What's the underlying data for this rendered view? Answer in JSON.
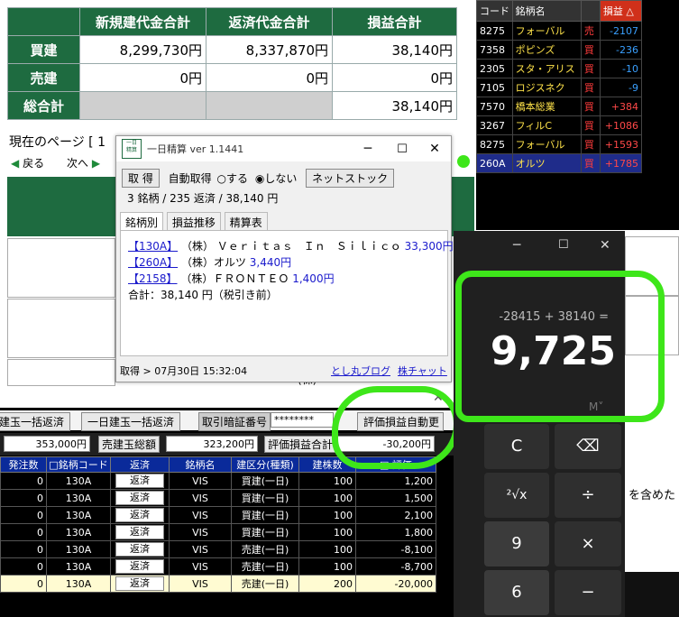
{
  "summary": {
    "headers": [
      "新規建代金合計",
      "返済代金合計",
      "損益合計"
    ],
    "rows": [
      {
        "label": "買建",
        "values": [
          "8,299,730円",
          "8,337,870円",
          "38,140円"
        ]
      },
      {
        "label": "売建",
        "values": [
          "0円",
          "0円",
          "0円"
        ]
      },
      {
        "label": "総合計",
        "values": [
          "",
          "",
          "38,140円"
        ]
      }
    ]
  },
  "page_nav": {
    "current_page_label": "現在のページ [ 1",
    "back_label": "戻る",
    "next_label": "次へ",
    "back_arrow": "◀",
    "next_arrow": "▶"
  },
  "stock_list": {
    "headers": [
      "コード",
      "銘柄名",
      "",
      "損益 △"
    ],
    "rows": [
      {
        "code": "8275",
        "name": "フォーバル",
        "side": "売",
        "pnl": "-2107",
        "sign": "neg"
      },
      {
        "code": "7358",
        "name": "ポピンズ",
        "side": "買",
        "pnl": "-236",
        "sign": "neg"
      },
      {
        "code": "2305",
        "name": "スタ・アリス",
        "side": "買",
        "pnl": "-10",
        "sign": "neg"
      },
      {
        "code": "7105",
        "name": "ロジスネク",
        "side": "買",
        "pnl": "-9",
        "sign": "neg"
      },
      {
        "code": "7570",
        "name": "橋本総業",
        "side": "買",
        "pnl": "+384",
        "sign": "pos"
      },
      {
        "code": "3267",
        "name": "フィルC",
        "side": "買",
        "pnl": "+1086",
        "sign": "pos"
      },
      {
        "code": "8275",
        "name": "フォーバル",
        "side": "買",
        "pnl": "+1593",
        "sign": "pos"
      },
      {
        "code": "260A",
        "name": "オルツ",
        "side": "買",
        "pnl": "+1785",
        "sign": "pos"
      }
    ]
  },
  "ichinichi": {
    "title": "一日精算 ver 1.1441",
    "icon_text": "一日\n精算",
    "get_button": "取 得",
    "auto_get_label": "自動取得",
    "radio_on": "する",
    "radio_off": "しない",
    "netstock_button": "ネットストック",
    "summary_line": "3 銘柄 / 235 返済 / 38,140 円",
    "tabs": [
      "銘柄別",
      "損益推移",
      "精算表"
    ],
    "items": [
      {
        "code": "【130A】",
        "name": "（株） Ｖｅｒｉｔａｓ　Ｉｎ　Ｓｉｌｉｃｏ",
        "amount": "33,300円"
      },
      {
        "code": "【260A】",
        "name": "（株）オルツ",
        "amount": "3,440円"
      },
      {
        "code": "【2158】",
        "name": "（株）ＦＲＯＮＴＥＯ",
        "amount": "1,400円"
      }
    ],
    "total_line": "合計：38,140 円（税引き前）",
    "status": "取得 > 07月30日 15:32:04",
    "link_blog": "とし丸ブログ",
    "link_chart": "株チャット"
  },
  "behind_text": "(株)",
  "right_behind_text": "を含めた",
  "trade_panel": {
    "btn_bulk_repay": "建玉一括返済",
    "btn_day_bulk": "一日建玉一括返済",
    "pin_label": "取引暗証番号",
    "pin_value": "********",
    "auto_label": "評価損益自動更",
    "amount_left": "353,000円",
    "sell_total_label": "売建玉総額",
    "sell_total_value": "323,200円",
    "eval_label": "評価損益合計",
    "eval_value": "-30,200円",
    "columns": [
      "発注数",
      "□銘柄コード",
      "返済",
      "銘柄名",
      "建区分(種類)",
      "建株数",
      "□ 評価"
    ],
    "rows": [
      {
        "qty": "0",
        "code": "130A",
        "btn": "返済",
        "name": "VIS",
        "type": "買建(一日)",
        "shares": "100",
        "pnl": "1,200"
      },
      {
        "qty": "0",
        "code": "130A",
        "btn": "返済",
        "name": "VIS",
        "type": "買建(一日)",
        "shares": "100",
        "pnl": "1,500"
      },
      {
        "qty": "0",
        "code": "130A",
        "btn": "返済",
        "name": "VIS",
        "type": "買建(一日)",
        "shares": "100",
        "pnl": "2,100"
      },
      {
        "qty": "0",
        "code": "130A",
        "btn": "返済",
        "name": "VIS",
        "type": "買建(一日)",
        "shares": "100",
        "pnl": "1,800"
      },
      {
        "qty": "0",
        "code": "130A",
        "btn": "返済",
        "name": "VIS",
        "type": "売建(一日)",
        "shares": "100",
        "pnl": "-8,100"
      },
      {
        "qty": "0",
        "code": "130A",
        "btn": "返済",
        "name": "VIS",
        "type": "売建(一日)",
        "shares": "100",
        "pnl": "-8,700"
      },
      {
        "qty": "0",
        "code": "130A",
        "btn": "返済",
        "name": "VIS",
        "type": "売建(一日)",
        "shares": "200",
        "pnl": "-20,000"
      }
    ]
  },
  "calculator": {
    "expression": "-28415 + 38140 =",
    "result": "9,725",
    "mem_label": "M˅",
    "keys": [
      "C",
      "⌫",
      "²√x",
      "÷",
      "9",
      "×",
      "6",
      "−"
    ]
  },
  "colors": {
    "header_green": "#1e6b40",
    "annotation_green": "#3ee61a",
    "calc_bg": "#202020"
  }
}
